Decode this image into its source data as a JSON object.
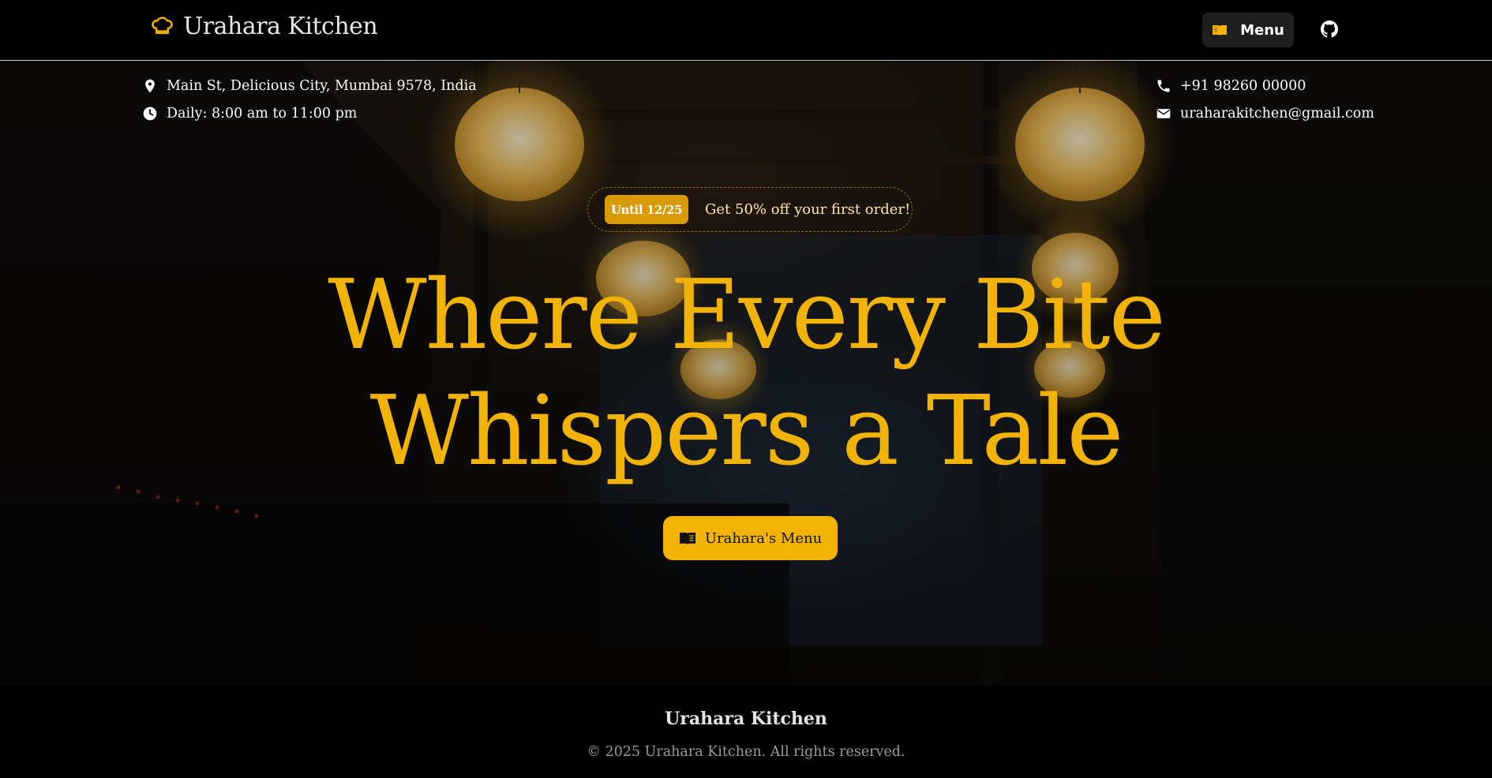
{
  "navbar": {
    "brand_name": "Urahara Kitchen",
    "brand_icon": "chef-hat-icon",
    "menu_label": "Menu",
    "menu_icon": "book-open-icon",
    "github_icon": "github-icon"
  },
  "info": {
    "address": "Main St, Delicious City, Mumbai 9578, India",
    "hours": "Daily: 8:00 am to 11:00 pm",
    "phone": "+91 98260 00000",
    "email": "uraharakitchen@gmail.com"
  },
  "promo": {
    "badge": "Until 12/25",
    "text": "Get 50% off your first order!"
  },
  "hero": {
    "headline_line1": "Where Every Bite",
    "headline_line2": "Whispers a Tale",
    "cta_label": "Urahara's Menu"
  },
  "footer": {
    "title": "Urahara Kitchen",
    "copyright": "© 2025 Urahara Kitchen. All rights reserved."
  },
  "colors": {
    "accent": "#f2b305",
    "badge": "#d99a07",
    "background": "#000000"
  }
}
